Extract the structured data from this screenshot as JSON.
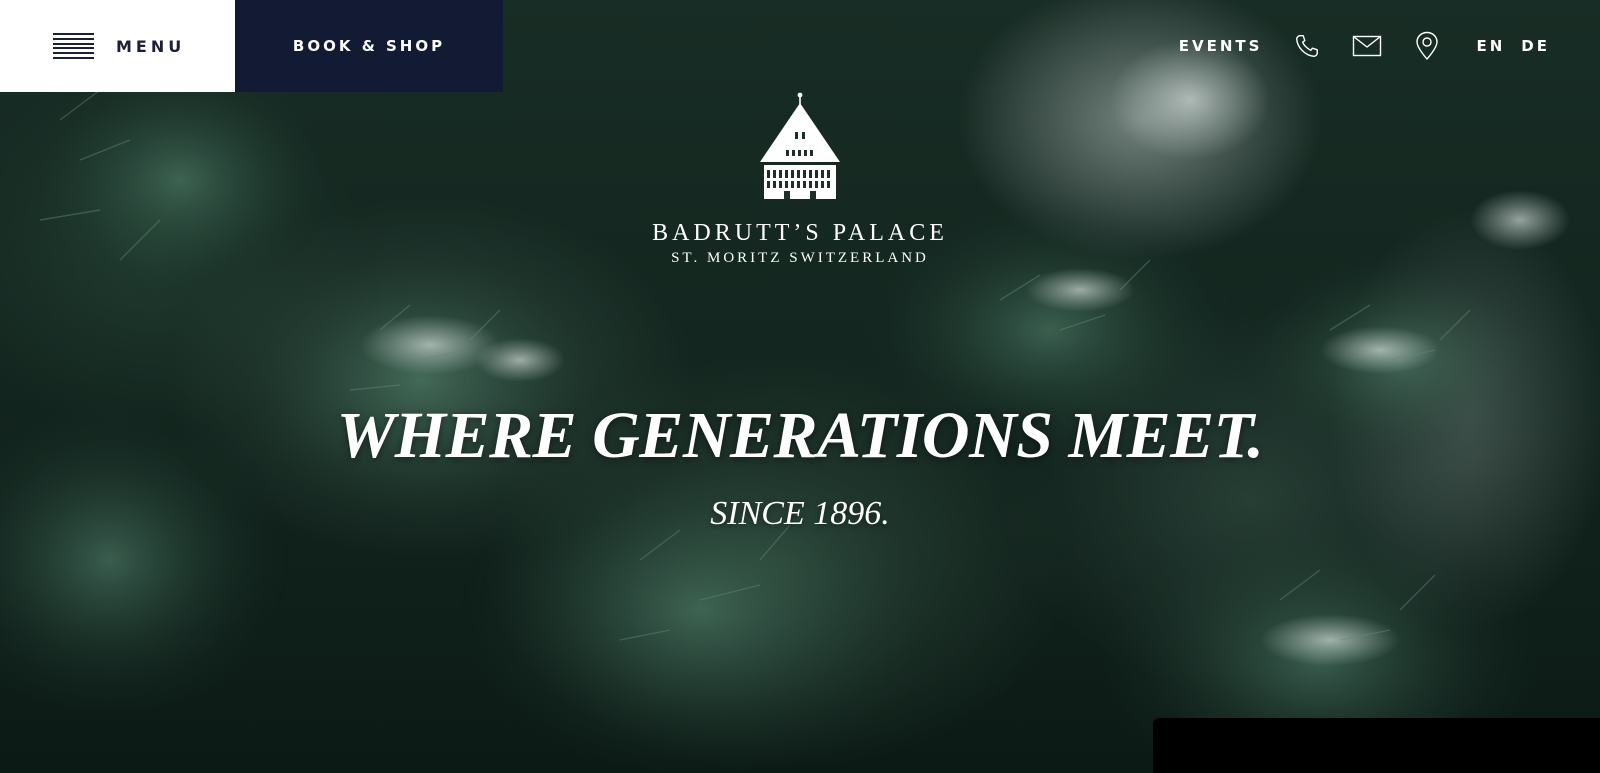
{
  "header": {
    "menu_label": "MENU",
    "book_label": "BOOK & SHOP",
    "events_label": "EVENTS",
    "lang_en": "EN",
    "lang_de": "DE",
    "icons": [
      "phone-icon",
      "mail-icon",
      "location-pin-icon"
    ]
  },
  "logo": {
    "name": "BADRUTT’S PALACE",
    "location": "ST. MORITZ  SWITZERLAND"
  },
  "hero": {
    "headline": "WHERE GENERATIONS MEET.",
    "subline": "SINCE 1896."
  },
  "colors": {
    "navy": "#131a33",
    "white": "#ffffff",
    "forest": "#13261f"
  }
}
